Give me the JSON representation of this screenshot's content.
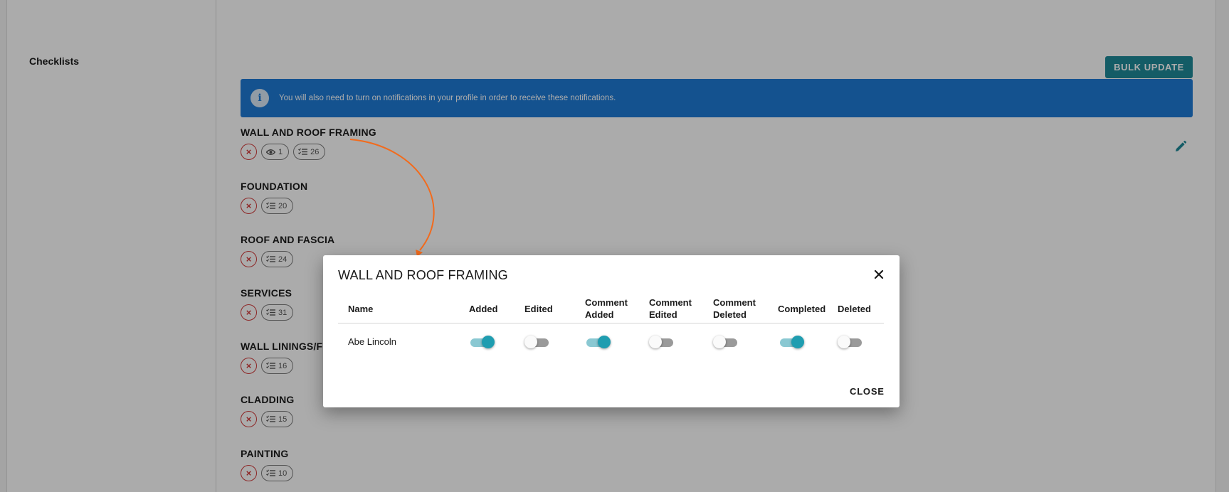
{
  "sidebar": {
    "title": "Checklists"
  },
  "toolbar": {
    "bulk_update_label": "BULK UPDATE"
  },
  "banner": {
    "icon": "info-icon",
    "icon_glyph": "i",
    "text": "You will also need to turn on notifications in your profile in order to receive these notifications."
  },
  "sections": [
    {
      "title": "WALL AND ROOF FRAMING",
      "watchers": "1",
      "items": "26"
    },
    {
      "title": "FOUNDATION",
      "items": "20"
    },
    {
      "title": "ROOF AND FASCIA",
      "items": "24"
    },
    {
      "title": "SERVICES",
      "items": "31"
    },
    {
      "title": "WALL LININGS/FI",
      "items": "16"
    },
    {
      "title": "CLADDING",
      "items": "15"
    },
    {
      "title": "PAINTING",
      "items": "10"
    }
  ],
  "chip_remove_glyph": "×",
  "modal": {
    "title": "WALL AND ROOF FRAMING",
    "columns": {
      "name": "Name",
      "added": "Added",
      "edited": "Edited",
      "comment_added_1": "Comment",
      "comment_added_2": "Added",
      "comment_edited_1": "Comment",
      "comment_edited_2": "Edited",
      "comment_deleted_1": "Comment",
      "comment_deleted_2": "Deleted",
      "completed": "Completed",
      "deleted": "Deleted"
    },
    "row": {
      "name": "Abe Lincoln",
      "added": true,
      "edited": false,
      "comment_added": true,
      "comment_edited": false,
      "comment_deleted": false,
      "completed": true,
      "deleted": false
    },
    "close_label": "CLOSE"
  },
  "colors": {
    "accent": "#1f9db0",
    "banner": "#1e7bd6",
    "danger": "#d33a3a",
    "annotation_arrow": "#f26b1d"
  }
}
